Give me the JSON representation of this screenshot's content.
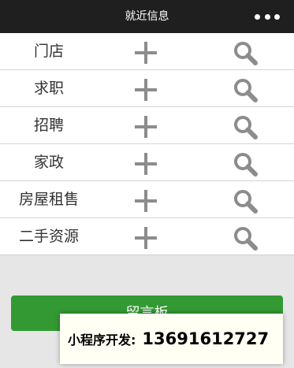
{
  "app": {
    "title": "就近信息"
  },
  "menu": {
    "more_icon": "more-dots-icon"
  },
  "list": {
    "items": [
      {
        "label": "门店",
        "add_icon": "plus-icon",
        "search_icon": "search-icon"
      },
      {
        "label": "求职",
        "add_icon": "plus-icon",
        "search_icon": "search-icon"
      },
      {
        "label": "招聘",
        "add_icon": "plus-icon",
        "search_icon": "search-icon"
      },
      {
        "label": "家政",
        "add_icon": "plus-icon",
        "search_icon": "search-icon"
      },
      {
        "label": "房屋租售",
        "add_icon": "plus-icon",
        "search_icon": "search-icon"
      },
      {
        "label": "二手资源",
        "add_icon": "plus-icon",
        "search_icon": "search-icon"
      }
    ]
  },
  "actions": {
    "board_button_label": "留言板"
  },
  "promo": {
    "label": "小程序开发:",
    "phone": "13691612727"
  },
  "colors": {
    "topbar": "#1f1f1f",
    "icon_gray": "#8c8c8c",
    "button_green": "#339933",
    "page_background": "#e6e6e6"
  }
}
